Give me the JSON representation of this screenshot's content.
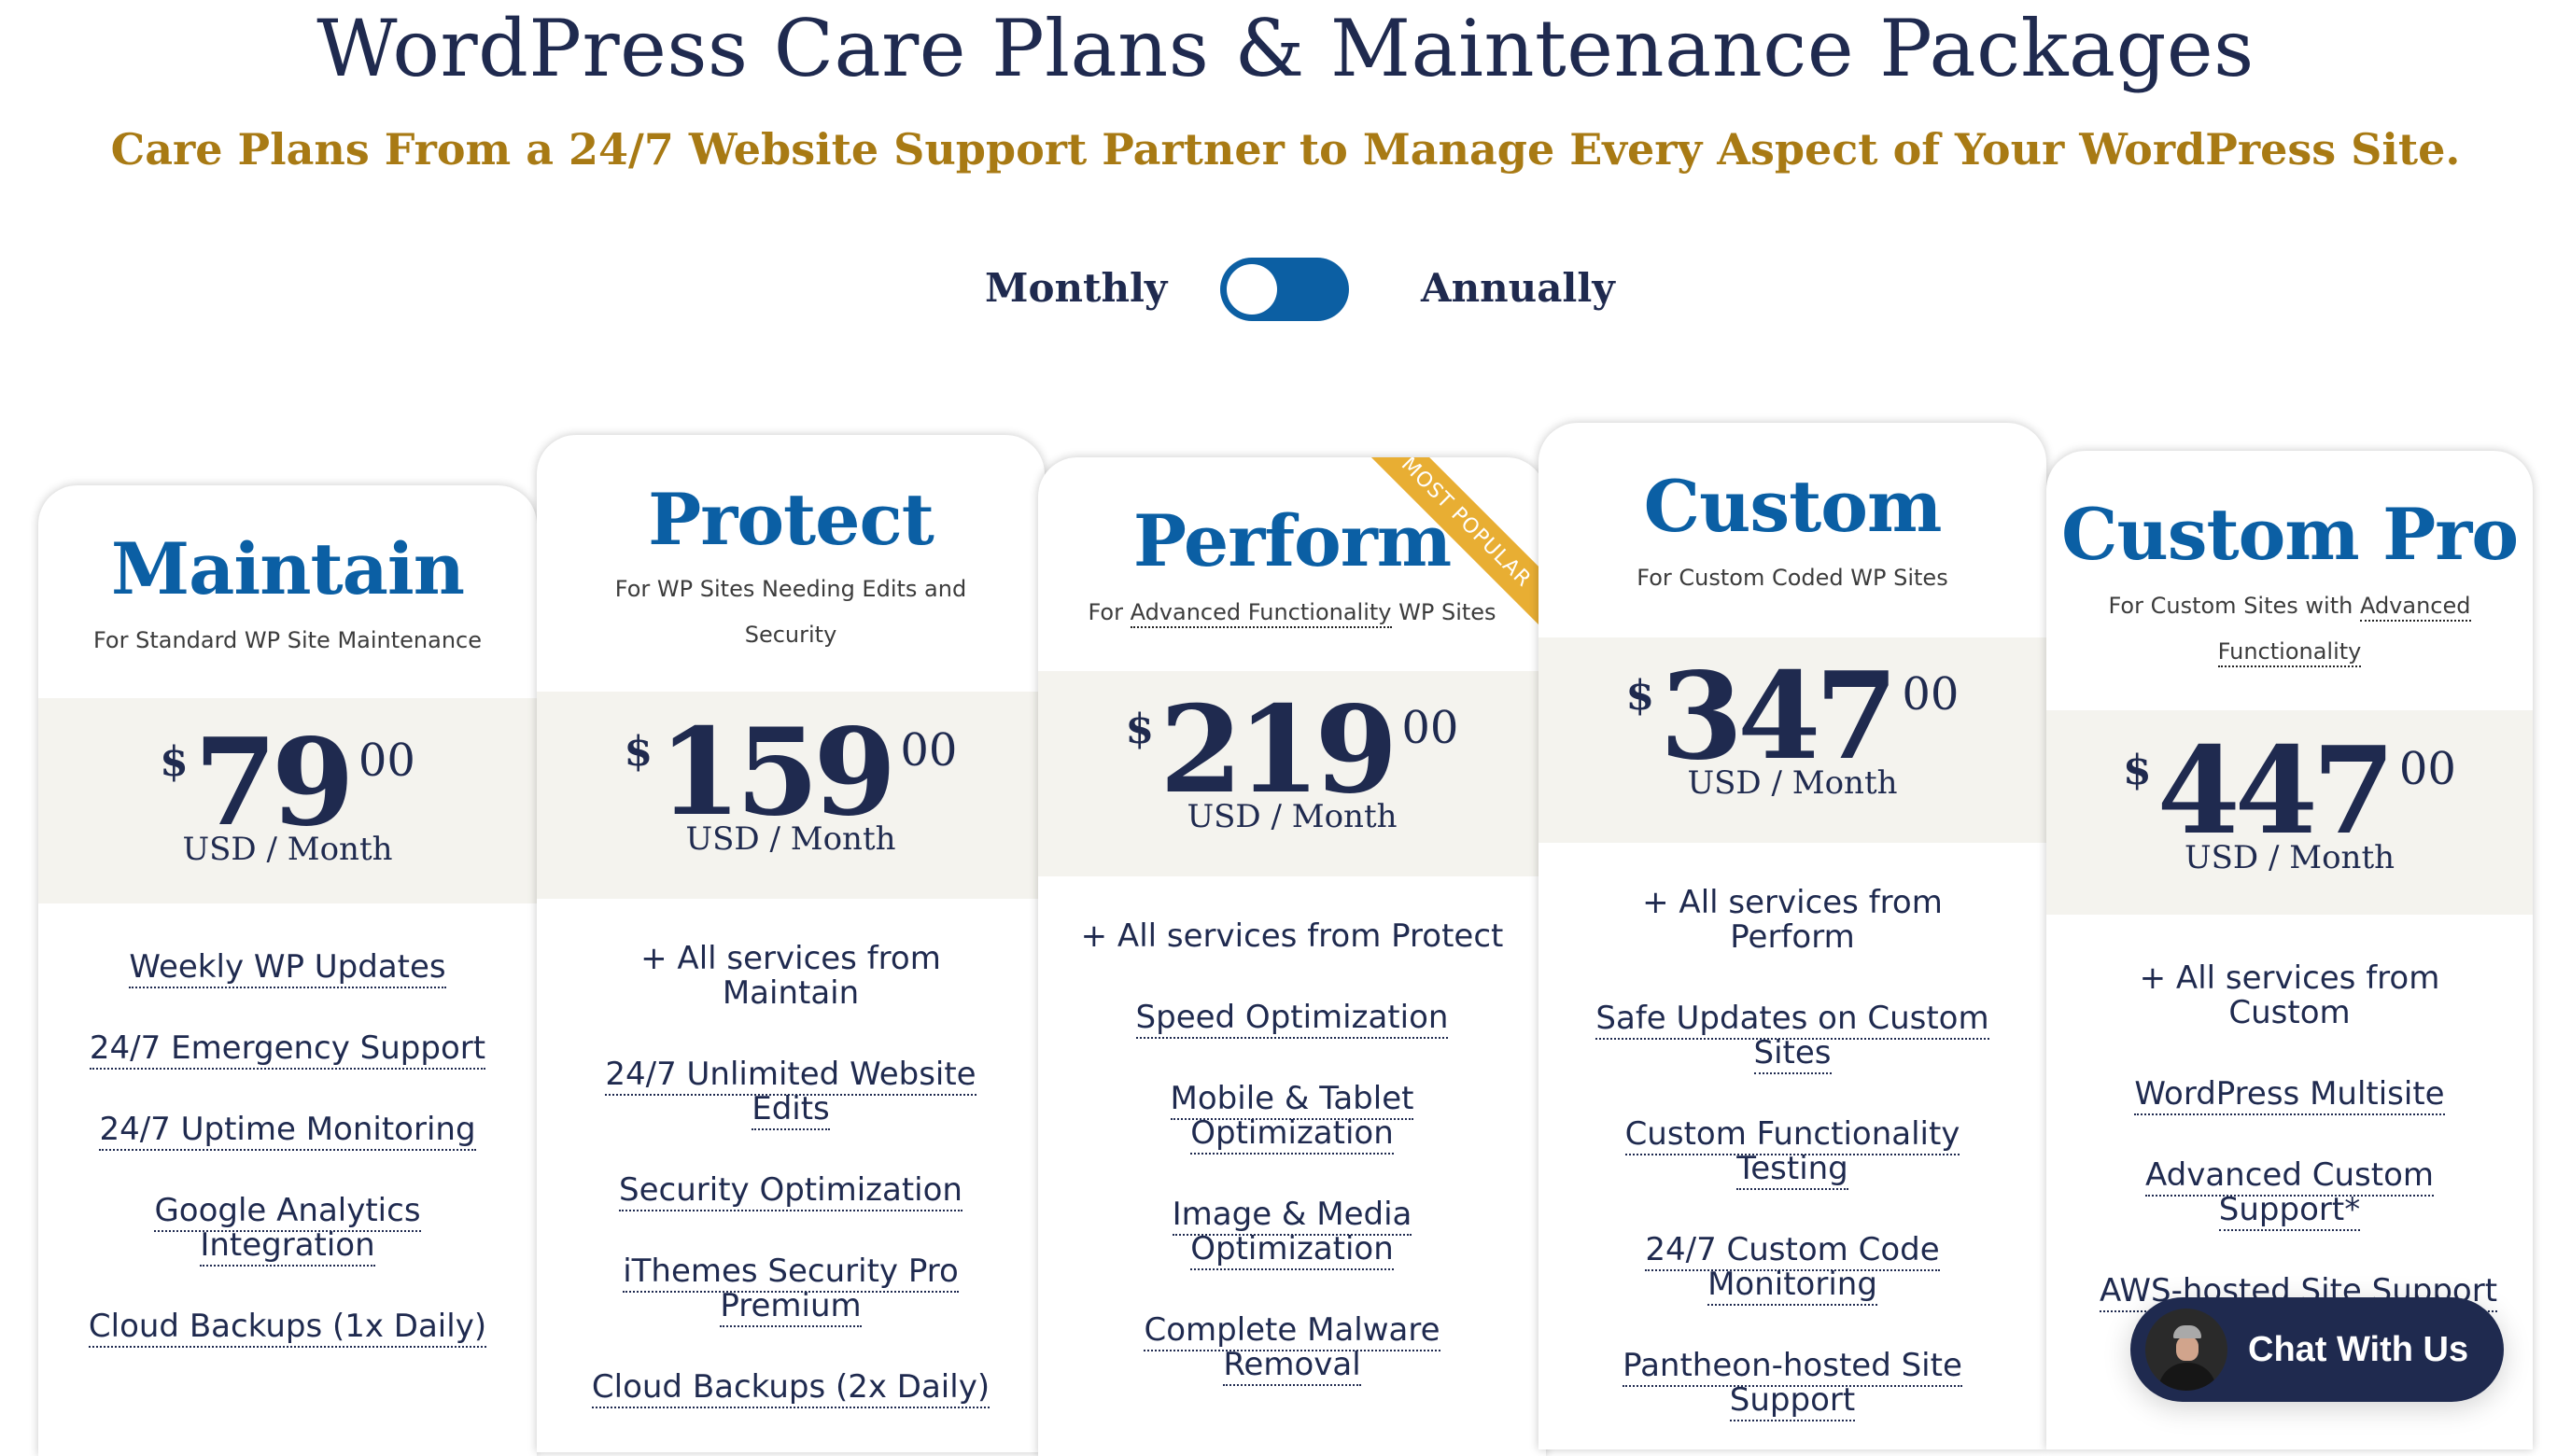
{
  "header": {
    "title": "WordPress Care Plans & Maintenance Packages",
    "subtitle": "Care Plans From a 24/7 Website Support Partner to Manage Every Aspect of Your WordPress Site."
  },
  "billing_toggle": {
    "left_label": "Monthly",
    "right_label": "Annually",
    "selected": "Monthly"
  },
  "colors": {
    "navy": "#1f2a4f",
    "plan_blue": "#0b5fa4",
    "gold": "#a87a14",
    "ribbon": "#e8ae33",
    "price_band": "#f4f3ee"
  },
  "plans": [
    {
      "name": "Maintain",
      "description": "For Standard WP Site Maintenance",
      "description_linked": "",
      "currency": "$",
      "amount": "79",
      "cents": "00",
      "unit": "USD / Month",
      "features": [
        {
          "text": "Weekly WP Updates",
          "linked": true
        },
        {
          "text": "24/7 Emergency Support",
          "linked": true
        },
        {
          "text": "24/7 Uptime Monitoring",
          "linked": true
        },
        {
          "text": "Google Analytics Integration",
          "linked": true
        },
        {
          "text": "Cloud Backups (1x Daily)",
          "linked": true
        }
      ]
    },
    {
      "name": "Protect",
      "description": "For WP Sites Needing Edits and Security",
      "currency": "$",
      "amount": "159",
      "cents": "00",
      "unit": "USD / Month",
      "features": [
        {
          "text": "+ All services from Maintain",
          "linked": false
        },
        {
          "text": "24/7 Unlimited Website Edits",
          "linked": true
        },
        {
          "text": "Security Optimization",
          "linked": true
        },
        {
          "text": "iThemes Security Pro Premium",
          "linked": true
        },
        {
          "text": "Cloud Backups (2x Daily)",
          "linked": true
        }
      ]
    },
    {
      "name": "Perform",
      "description_prefix": "For ",
      "description_link": "Advanced Functionality",
      "description_suffix": " WP Sites",
      "badge": "MOST POPULAR",
      "currency": "$",
      "amount": "219",
      "cents": "00",
      "unit": "USD / Month",
      "features": [
        {
          "text": "+ All services from Protect",
          "linked": false
        },
        {
          "text": "Speed Optimization",
          "linked": true
        },
        {
          "text": "Mobile & Tablet Optimization",
          "linked": true
        },
        {
          "text": "Image & Media Optimization",
          "linked": true
        },
        {
          "text": "Complete Malware Removal",
          "linked": true
        }
      ]
    },
    {
      "name": "Custom",
      "description": "For Custom Coded WP Sites",
      "currency": "$",
      "amount": "347",
      "cents": "00",
      "unit": "USD / Month",
      "features": [
        {
          "text": "+ All services from Perform",
          "linked": false
        },
        {
          "text": "Safe Updates on Custom Sites",
          "linked": true
        },
        {
          "text": "Custom Functionality Testing",
          "linked": true
        },
        {
          "text": "24/7 Custom Code Monitoring",
          "linked": true
        },
        {
          "text": "Pantheon-hosted Site Support",
          "linked": true
        }
      ]
    },
    {
      "name": "Custom Pro",
      "description_prefix": "For Custom Sites with ",
      "description_link": "Advanced Functionality",
      "currency": "$",
      "amount": "447",
      "cents": "00",
      "unit": "USD / Month",
      "features": [
        {
          "text": "+ All services from Custom",
          "linked": false
        },
        {
          "text": "WordPress Multisite",
          "linked": true
        },
        {
          "text": "Advanced Custom Support*",
          "linked": true
        },
        {
          "text": "AWS-hosted Site Support",
          "linked": true
        }
      ]
    }
  ],
  "chat_widget": {
    "label": "Chat With Us",
    "avatar": "support-agent-photo"
  }
}
